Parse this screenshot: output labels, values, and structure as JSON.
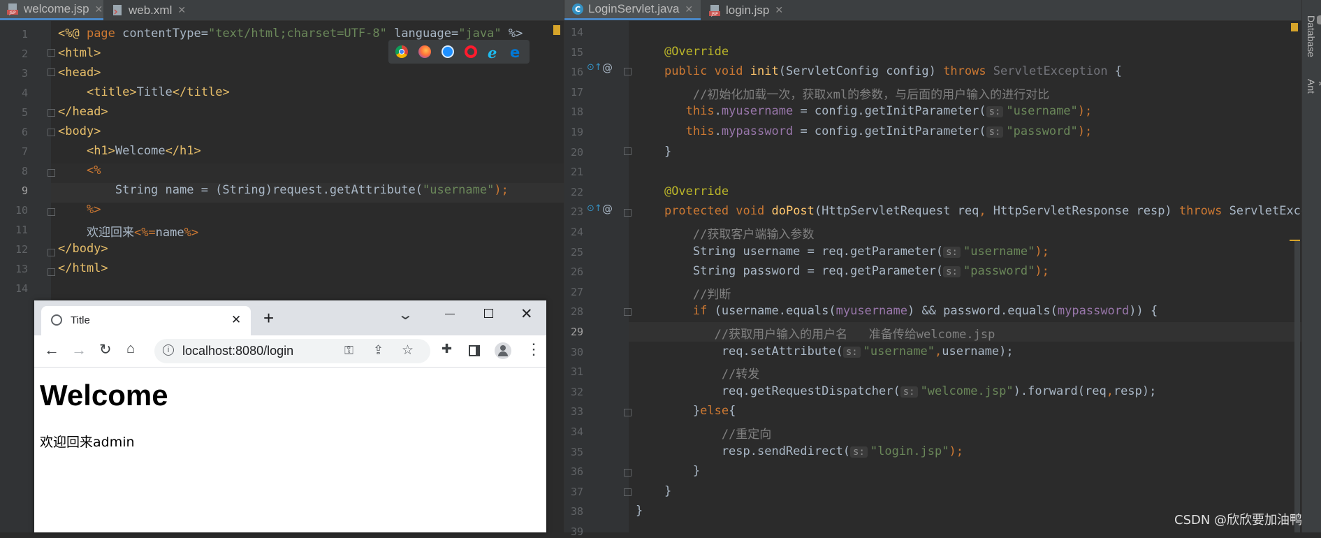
{
  "left_editor": {
    "tabs": [
      {
        "label": "welcome.jsp",
        "active": true
      },
      {
        "label": "web.xml",
        "active": false
      }
    ],
    "line_numbers": [
      "1",
      "2",
      "3",
      "4",
      "5",
      "6",
      "7",
      "8",
      "9",
      "10",
      "11",
      "12",
      "13",
      "14"
    ],
    "current_line": "9",
    "lines": [
      [
        [
          "<%@ ",
          "tag"
        ],
        [
          "page",
          "kw"
        ],
        [
          " contentType=",
          "t"
        ],
        [
          "\"text/html;charset=UTF-8\"",
          "str"
        ],
        [
          " language=",
          "t"
        ],
        [
          "\"java\"",
          "str"
        ],
        [
          " %>",
          "t"
        ]
      ],
      [
        [
          "<html>",
          "tag"
        ]
      ],
      [
        [
          "<head>",
          "tag"
        ]
      ],
      [
        [
          "    ",
          "t"
        ],
        [
          "<title>",
          "tag"
        ],
        [
          "Title",
          "t"
        ],
        [
          "</title>",
          "tag"
        ]
      ],
      [
        [
          "</head>",
          "tag"
        ]
      ],
      [
        [
          "<body>",
          "tag"
        ]
      ],
      [
        [
          "    ",
          "t"
        ],
        [
          "<h1>",
          "tag"
        ],
        [
          "Welcome",
          "t"
        ],
        [
          "</h1>",
          "tag"
        ]
      ],
      [
        [
          "    ",
          "t"
        ],
        [
          "<%",
          "kw"
        ]
      ],
      [
        [
          "        String name = (String)request.getAttribute(",
          "t"
        ],
        [
          "\"username\"",
          "str"
        ],
        [
          ");",
          "kw"
        ]
      ],
      [
        [
          "    ",
          "t"
        ],
        [
          "%>",
          "kw"
        ]
      ],
      [
        [
          "    欢迎回来",
          "t"
        ],
        [
          "<%=",
          "kw"
        ],
        [
          "name",
          "t"
        ],
        [
          "%>",
          "kw"
        ]
      ],
      [
        [
          "</body>",
          "tag"
        ]
      ],
      [
        [
          "</html>",
          "tag"
        ]
      ],
      [
        [
          "",
          "t"
        ]
      ]
    ]
  },
  "browser_icons": [
    "chrome-icon",
    "firefox-icon",
    "safari-icon",
    "opera-icon",
    "ie-icon",
    "edge-icon"
  ],
  "browser": {
    "tab_title": "Title",
    "new_tab_symbol": "+",
    "address": "localhost:8080/login",
    "heading": "Welcome",
    "body_text": "欢迎回来admin"
  },
  "right_editor": {
    "tabs": [
      {
        "label": "LoginServlet.java",
        "active": true
      },
      {
        "label": "login.jsp",
        "active": false
      }
    ],
    "line_numbers": [
      "14",
      "15",
      "16",
      "17",
      "18",
      "19",
      "20",
      "21",
      "22",
      "23",
      "24",
      "25",
      "26",
      "27",
      "28",
      "29",
      "30",
      "31",
      "32",
      "33",
      "34",
      "35",
      "36",
      "37",
      "38",
      "39"
    ],
    "current_line": "29",
    "lines": [
      [
        [
          "",
          "t"
        ]
      ],
      [
        [
          "    ",
          "t"
        ],
        [
          "@Override",
          "ann"
        ]
      ],
      [
        [
          "    ",
          "t"
        ],
        [
          "public void ",
          "kw"
        ],
        [
          "init",
          "fn"
        ],
        [
          "(ServletConfig config) ",
          "t"
        ],
        [
          "throws ",
          "kw"
        ],
        [
          "ServletException",
          "gray"
        ],
        [
          " {",
          "t"
        ]
      ],
      [
        [
          "        ",
          "t"
        ],
        [
          "//初始化加载一次，获取xml的参数，与后面的用户输入的进行对比",
          "cmt"
        ]
      ],
      [
        [
          "       ",
          "t"
        ],
        [
          "this",
          "kw"
        ],
        [
          ".",
          "t"
        ],
        [
          "myusername",
          "fld"
        ],
        [
          " = config.getInitParameter(",
          "t"
        ],
        [
          "s:",
          "hint"
        ],
        [
          "\"username\"",
          "str"
        ],
        [
          ");",
          "kw"
        ]
      ],
      [
        [
          "       ",
          "t"
        ],
        [
          "this",
          "kw"
        ],
        [
          ".",
          "t"
        ],
        [
          "mypassword",
          "fld"
        ],
        [
          " = config.getInitParameter(",
          "t"
        ],
        [
          "s:",
          "hint"
        ],
        [
          "\"password\"",
          "str"
        ],
        [
          ");",
          "kw"
        ]
      ],
      [
        [
          "    }",
          "t"
        ]
      ],
      [
        [
          "",
          "t"
        ]
      ],
      [
        [
          "    ",
          "t"
        ],
        [
          "@Override",
          "ann"
        ]
      ],
      [
        [
          "    ",
          "t"
        ],
        [
          "protected void ",
          "kw"
        ],
        [
          "doPost",
          "fn"
        ],
        [
          "(HttpServletRequest req",
          "t"
        ],
        [
          ", ",
          "kw"
        ],
        [
          "HttpServletResponse resp) ",
          "t"
        ],
        [
          "throws ",
          "kw"
        ],
        [
          "ServletExcept",
          "t"
        ]
      ],
      [
        [
          "        ",
          "t"
        ],
        [
          "//获取客户端输入参数",
          "cmt"
        ]
      ],
      [
        [
          "        String username = req.getParameter(",
          "t"
        ],
        [
          "s:",
          "hint"
        ],
        [
          "\"username\"",
          "str"
        ],
        [
          ");",
          "kw"
        ]
      ],
      [
        [
          "        String password = req.getParameter(",
          "t"
        ],
        [
          "s:",
          "hint"
        ],
        [
          "\"password\"",
          "str"
        ],
        [
          ");",
          "kw"
        ]
      ],
      [
        [
          "        ",
          "t"
        ],
        [
          "//判断",
          "cmt"
        ]
      ],
      [
        [
          "        ",
          "t"
        ],
        [
          "if ",
          "kw"
        ],
        [
          "(username.equals(",
          "t"
        ],
        [
          "myusername",
          "fld"
        ],
        [
          ") && password.equals(",
          "t"
        ],
        [
          "mypassword",
          "fld"
        ],
        [
          ")) {",
          "t"
        ]
      ],
      [
        [
          "           ",
          "t"
        ],
        [
          "//获取用户输入的用户名   准备传给welcome.jsp",
          "cmt"
        ]
      ],
      [
        [
          "            req.setAttribute(",
          "t"
        ],
        [
          "s:",
          "hint"
        ],
        [
          "\"username\"",
          "str"
        ],
        [
          ",",
          "kw"
        ],
        [
          "username);",
          "t"
        ]
      ],
      [
        [
          "            ",
          "t"
        ],
        [
          "//转发",
          "cmt"
        ]
      ],
      [
        [
          "            req.getRequestDispatcher(",
          "t"
        ],
        [
          "s:",
          "hint"
        ],
        [
          "\"welcome.jsp\"",
          "str"
        ],
        [
          ").forward(req",
          ""
        ],
        [
          ",",
          "kw"
        ],
        [
          "resp);",
          "t"
        ]
      ],
      [
        [
          "        }",
          "t"
        ],
        [
          "else",
          "kw"
        ],
        [
          "{",
          "t"
        ]
      ],
      [
        [
          "            ",
          "t"
        ],
        [
          "//重定向",
          "cmt"
        ]
      ],
      [
        [
          "            resp.sendRedirect(",
          "t"
        ],
        [
          "s:",
          "hint"
        ],
        [
          "\"login.jsp\"",
          "str"
        ],
        [
          ");",
          "kw"
        ]
      ],
      [
        [
          "        }",
          "t"
        ]
      ],
      [
        [
          "    }",
          "t"
        ]
      ],
      [
        [
          "}",
          "t"
        ]
      ],
      [
        [
          "",
          "t"
        ]
      ]
    ]
  },
  "side_panel": {
    "items": [
      "Database",
      "Ant"
    ]
  },
  "watermark": "CSDN @欣欣要加油鸭"
}
